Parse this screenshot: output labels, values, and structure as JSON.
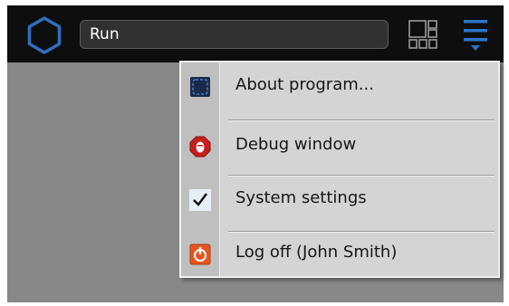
{
  "toolbar": {
    "logo_icon": "hexagon-logo-icon",
    "search_value": "Run",
    "grid_icon": "grid-layout-icon",
    "menu_icon": "hamburger-menu-icon",
    "accent_color": "#2a76c8"
  },
  "menu": {
    "items": [
      {
        "label": "About program...",
        "icon": "about-program-icon"
      },
      {
        "label": "Debug window",
        "icon": "debug-stop-icon"
      },
      {
        "label": "System settings",
        "icon": "checkmark-icon",
        "checked": true
      },
      {
        "label": "Log off (John Smith)",
        "icon": "power-logoff-icon"
      }
    ]
  }
}
